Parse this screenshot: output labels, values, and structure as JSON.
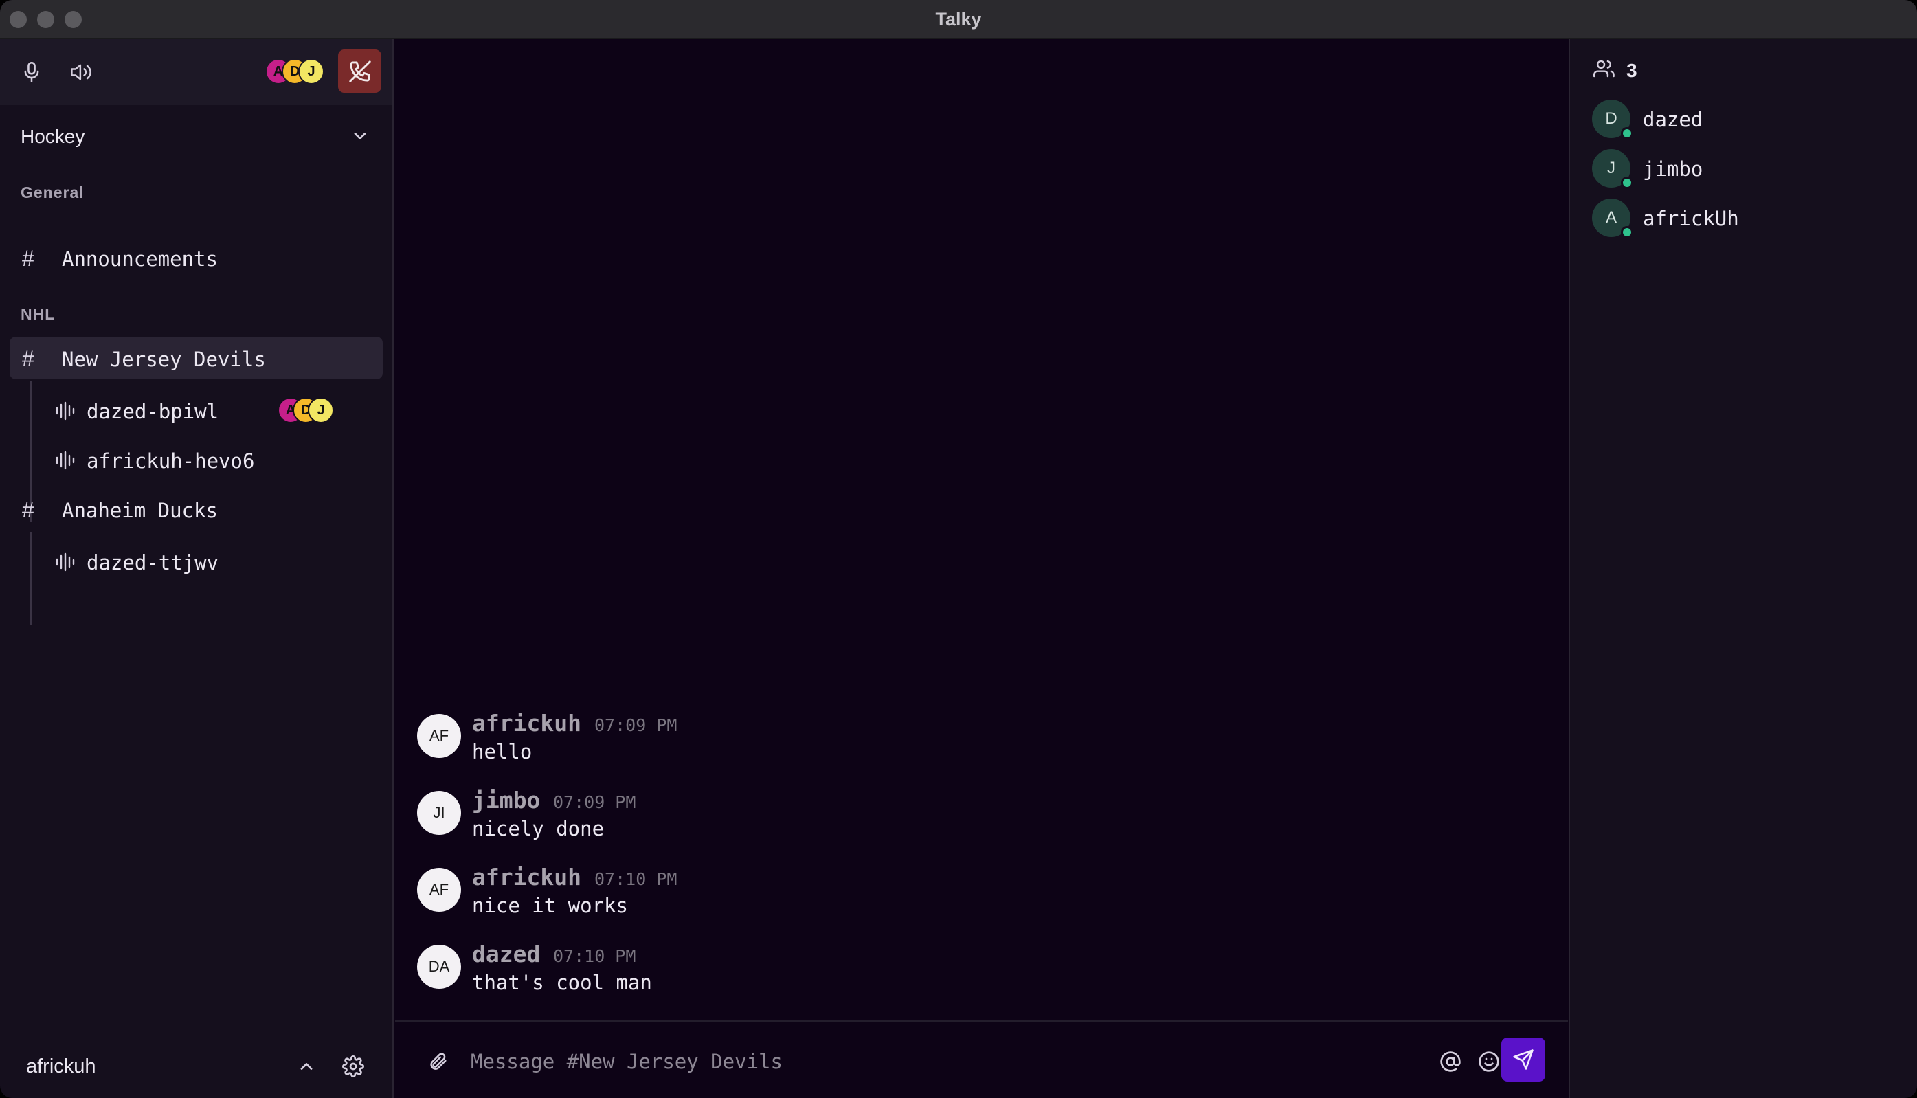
{
  "window": {
    "title": "Talky"
  },
  "voice_bar": {
    "participants": [
      {
        "initial": "A",
        "color": "#c51f8a"
      },
      {
        "initial": "D",
        "color": "#f5b829"
      },
      {
        "initial": "J",
        "color": "#f2e663"
      }
    ],
    "hangup_color": "#7a2a2a"
  },
  "server": {
    "name": "Hockey"
  },
  "sections": [
    {
      "name": "General",
      "channels": [
        {
          "name": "Announcements",
          "voice": []
        }
      ]
    },
    {
      "name": "NHL",
      "channels": [
        {
          "name": "New Jersey Devils",
          "active": true,
          "voice": [
            {
              "name": "dazed-bpiwl",
              "participants": [
                "A",
                "D",
                "J"
              ]
            },
            {
              "name": "africkuh-hevo6",
              "participants": []
            }
          ]
        },
        {
          "name": "Anaheim Ducks",
          "voice": [
            {
              "name": "dazed-ttjwv",
              "participants": []
            }
          ]
        }
      ]
    }
  ],
  "user": {
    "name": "africkuh"
  },
  "messages": [
    {
      "initials": "AF",
      "author": "africkuh",
      "time": "07:09 PM",
      "text": "hello"
    },
    {
      "initials": "JI",
      "author": "jimbo",
      "time": "07:09 PM",
      "text": "nicely done"
    },
    {
      "initials": "AF",
      "author": "africkuh",
      "time": "07:10 PM",
      "text": "nice it works"
    },
    {
      "initials": "DA",
      "author": "dazed",
      "time": "07:10 PM",
      "text": "that's cool man"
    }
  ],
  "composer": {
    "placeholder": "Message #New Jersey Devils"
  },
  "members": {
    "count": "3",
    "list": [
      {
        "initial": "D",
        "name": "dazed",
        "status": "online"
      },
      {
        "initial": "J",
        "name": "jimbo",
        "status": "online"
      },
      {
        "initial": "A",
        "name": "africkUh",
        "status": "online"
      }
    ]
  },
  "colors": {
    "accent": "#5a12c9",
    "online": "#2fc28d",
    "background": "#0d0316"
  }
}
